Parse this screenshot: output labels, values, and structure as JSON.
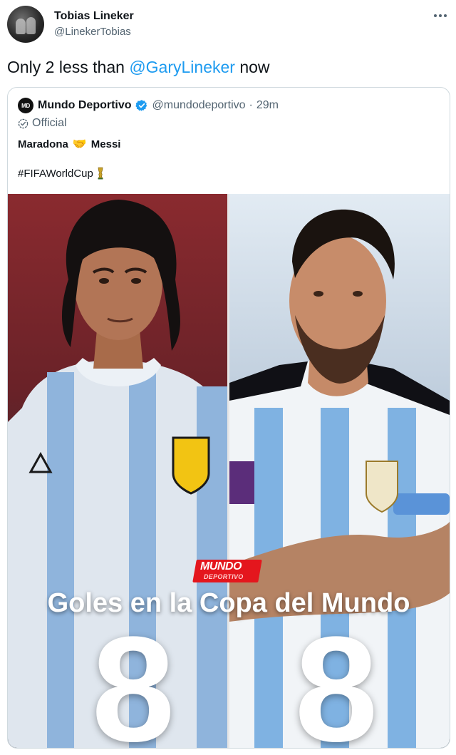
{
  "tweet": {
    "author_name": "Tobias Lineker",
    "author_handle": "@LinekerTobias",
    "text_before": "Only 2 less than ",
    "mention": "@GaryLineker",
    "text_after": " now"
  },
  "quoted_tweet": {
    "logo_text": "MD",
    "author_name": "Mundo Deportivo",
    "author_handle": "@mundodeportivo",
    "separator": "·",
    "time": "29m",
    "label": "Official",
    "line1_left": "Maradona",
    "line1_emoji": "🤝",
    "line1_right": "Messi",
    "hashtag": "#FIFAWorldCup",
    "media": {
      "brand_top": "MUNDO",
      "brand_bottom": "DEPORTIVO",
      "headline": "Goles en la Copa del Mundo",
      "left_score": "8",
      "right_score": "8"
    }
  },
  "icons": {
    "more": "more-horizontal-icon",
    "verified": "verified-badge-icon",
    "official": "official-label-icon",
    "trophy": "trophy-icon"
  },
  "colors": {
    "link": "#1d9bf0",
    "secondary_text": "#536471",
    "border": "#cfd9de",
    "brand_red": "#e4161d"
  }
}
